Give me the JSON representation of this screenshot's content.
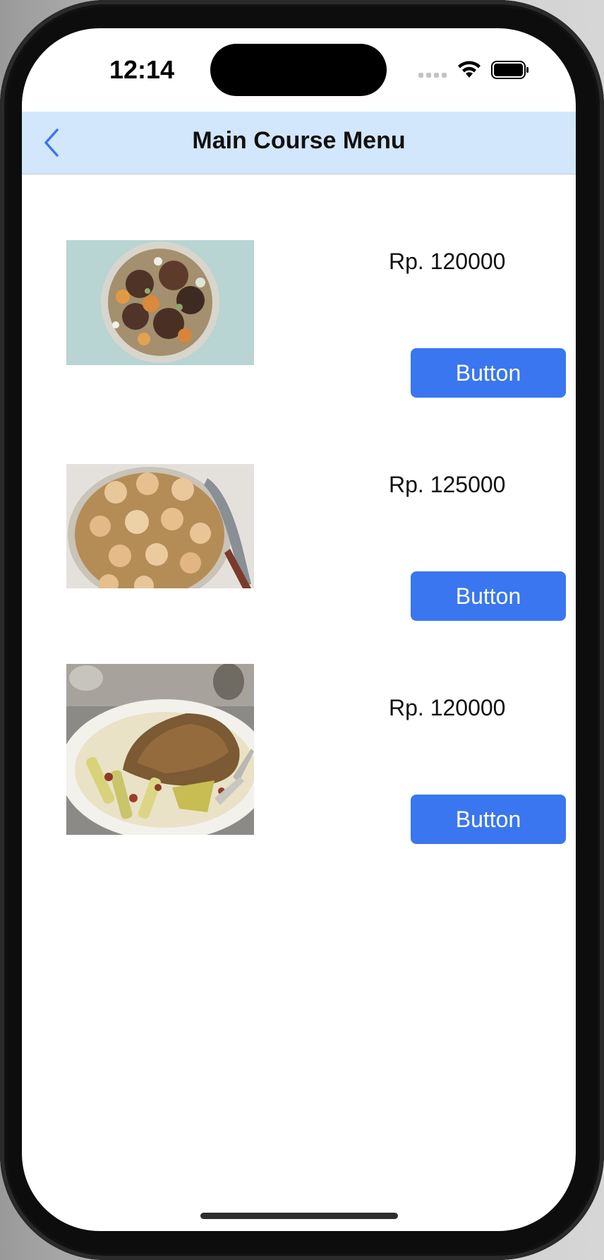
{
  "status_bar": {
    "time": "12:14"
  },
  "nav": {
    "title": "Main Course Menu",
    "back_icon": "chevron-left-icon"
  },
  "colors": {
    "nav_background": "#d2e7fb",
    "accent": "#3a76ef",
    "back_icon": "#3a76ef"
  },
  "menu": {
    "items": [
      {
        "price": "Rp. 120000",
        "button_label": "Button",
        "image": "grilled-chicken-with-oranges-photo"
      },
      {
        "price": "Rp. 125000",
        "button_label": "Button",
        "image": "seared-scallops-photo"
      },
      {
        "price": "Rp. 120000",
        "button_label": "Button",
        "image": "roast-chicken-with-leeks-photo"
      }
    ]
  }
}
